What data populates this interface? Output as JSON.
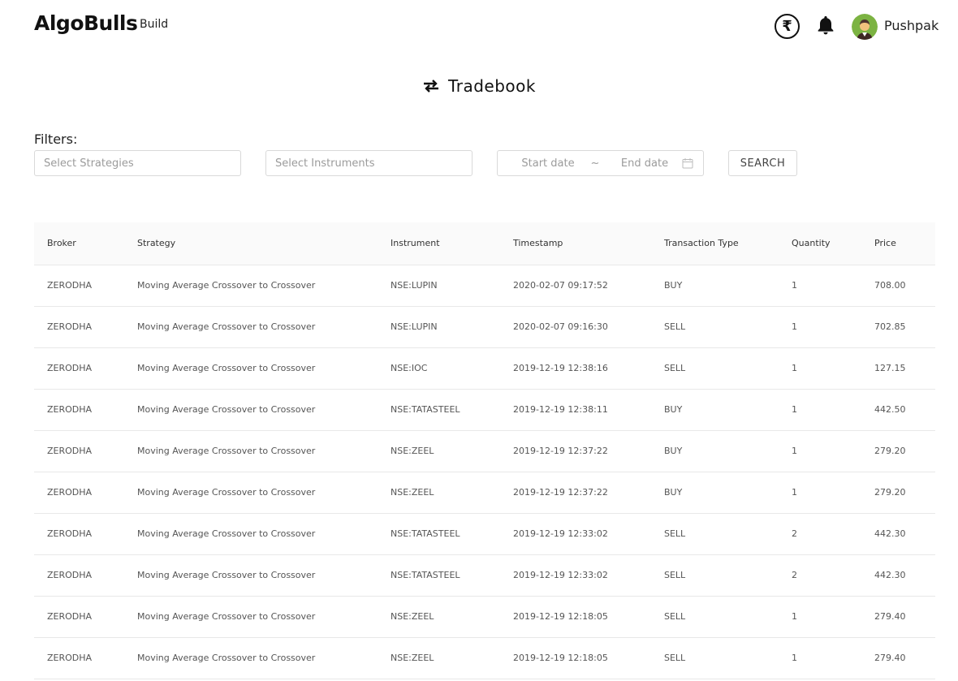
{
  "header": {
    "brand": "AlgoBulls",
    "nav_build": "Build",
    "rupee_symbol": "₹",
    "username": "Pushpak"
  },
  "page": {
    "title": "Tradebook"
  },
  "filters": {
    "label": "Filters:",
    "strategies_placeholder": "Select Strategies",
    "instruments_placeholder": "Select Instruments",
    "start_date_placeholder": "Start date",
    "separator": "~",
    "end_date_placeholder": "End date",
    "search_label": "SEARCH"
  },
  "table": {
    "columns": [
      "Broker",
      "Strategy",
      "Instrument",
      "Timestamp",
      "Transaction Type",
      "Quantity",
      "Price"
    ],
    "rows": [
      [
        "ZERODHA",
        "Moving Average Crossover to Crossover",
        "NSE:LUPIN",
        "2020-02-07 09:17:52",
        "BUY",
        "1",
        "708.00"
      ],
      [
        "ZERODHA",
        "Moving Average Crossover to Crossover",
        "NSE:LUPIN",
        "2020-02-07 09:16:30",
        "SELL",
        "1",
        "702.85"
      ],
      [
        "ZERODHA",
        "Moving Average Crossover to Crossover",
        "NSE:IOC",
        "2019-12-19 12:38:16",
        "SELL",
        "1",
        "127.15"
      ],
      [
        "ZERODHA",
        "Moving Average Crossover to Crossover",
        "NSE:TATASTEEL",
        "2019-12-19 12:38:11",
        "BUY",
        "1",
        "442.50"
      ],
      [
        "ZERODHA",
        "Moving Average Crossover to Crossover",
        "NSE:ZEEL",
        "2019-12-19 12:37:22",
        "BUY",
        "1",
        "279.20"
      ],
      [
        "ZERODHA",
        "Moving Average Crossover to Crossover",
        "NSE:ZEEL",
        "2019-12-19 12:37:22",
        "BUY",
        "1",
        "279.20"
      ],
      [
        "ZERODHA",
        "Moving Average Crossover to Crossover",
        "NSE:TATASTEEL",
        "2019-12-19 12:33:02",
        "SELL",
        "2",
        "442.30"
      ],
      [
        "ZERODHA",
        "Moving Average Crossover to Crossover",
        "NSE:TATASTEEL",
        "2019-12-19 12:33:02",
        "SELL",
        "2",
        "442.30"
      ],
      [
        "ZERODHA",
        "Moving Average Crossover to Crossover",
        "NSE:ZEEL",
        "2019-12-19 12:18:05",
        "SELL",
        "1",
        "279.40"
      ],
      [
        "ZERODHA",
        "Moving Average Crossover to Crossover",
        "NSE:ZEEL",
        "2019-12-19 12:18:05",
        "SELL",
        "1",
        "279.40"
      ]
    ]
  }
}
